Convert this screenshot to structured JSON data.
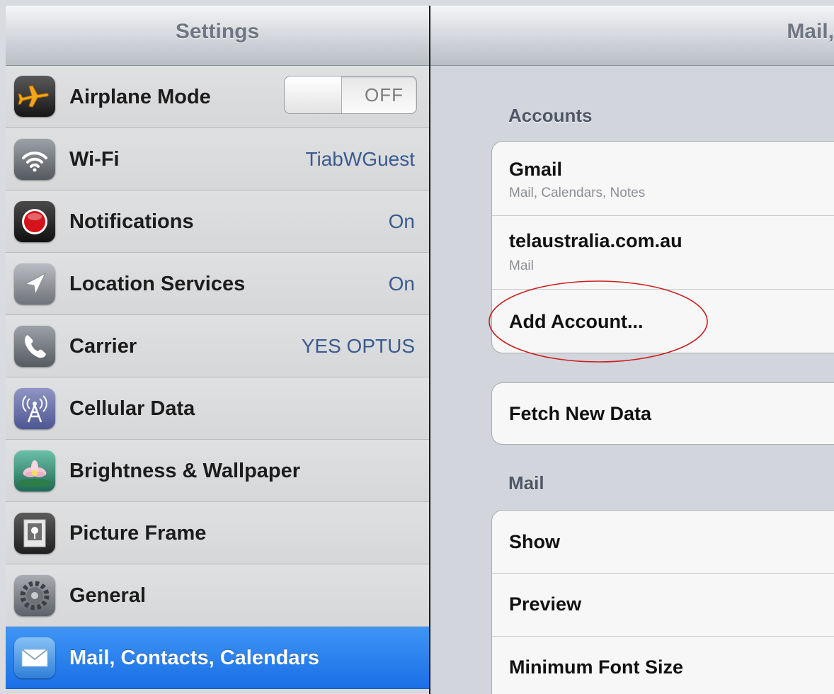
{
  "sidebar": {
    "title": "Settings",
    "items": [
      {
        "label": "Airplane Mode",
        "value": "",
        "icon": "airplane-icon"
      },
      {
        "label": "Wi-Fi",
        "value": "TiabWGuest",
        "icon": "wifi-icon"
      },
      {
        "label": "Notifications",
        "value": "On",
        "icon": "notifications-icon"
      },
      {
        "label": "Location Services",
        "value": "On",
        "icon": "location-arrow-icon"
      },
      {
        "label": "Carrier",
        "value": "YES OPTUS",
        "icon": "phone-icon"
      },
      {
        "label": "Cellular Data",
        "value": "",
        "icon": "antenna-icon"
      },
      {
        "label": "Brightness & Wallpaper",
        "value": "",
        "icon": "flower-icon"
      },
      {
        "label": "Picture Frame",
        "value": "",
        "icon": "picture-frame-icon"
      },
      {
        "label": "General",
        "value": "",
        "icon": "gear-icon"
      },
      {
        "label": "Mail, Contacts, Calendars",
        "value": "",
        "icon": "mail-icon",
        "selected": true
      }
    ],
    "airplane_toggle": "OFF"
  },
  "detail": {
    "title": "Mail,",
    "accounts_header": "Accounts",
    "accounts": [
      {
        "name": "Gmail",
        "detail": "Mail, Calendars, Notes"
      },
      {
        "name": "telaustralia.com.au",
        "detail": "Mail"
      }
    ],
    "add_account_label": "Add Account...",
    "fetch_label": "Fetch New Data",
    "mail_header": "Mail",
    "mail_rows": [
      "Show",
      "Preview",
      "Minimum Font Size"
    ]
  },
  "colors": {
    "selected_row": "#2a7fef",
    "value_text": "#3b5b8e",
    "annotation": "#cc1f1f"
  }
}
